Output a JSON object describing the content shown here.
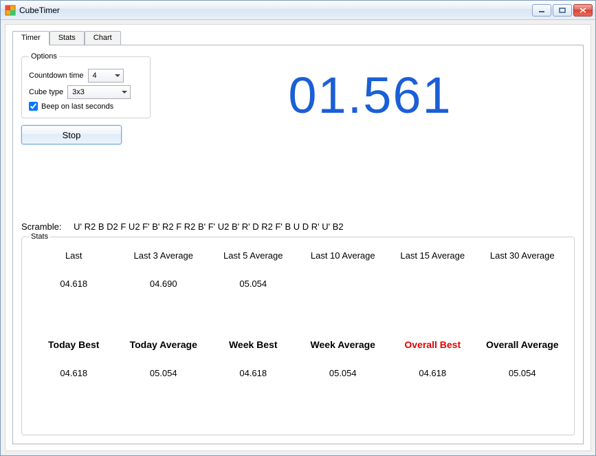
{
  "window": {
    "title": "CubeTimer"
  },
  "tabs": {
    "timer": "Timer",
    "stats": "Stats",
    "chart": "Chart"
  },
  "options": {
    "legend": "Options",
    "countdown_label": "Countdown time",
    "countdown_value": "4",
    "cube_type_label": "Cube type",
    "cube_type_value": "3x3",
    "beep_label": "Beep on last seconds",
    "beep_checked": true
  },
  "main": {
    "stop_label": "Stop",
    "timer_value": "01.561",
    "scramble_label": "Scramble:",
    "scramble_value": "U' R2 B D2 F U2 F' B' R2 F R2 B' F' U2 B' R' D R2 F' B U D R' U' B2"
  },
  "stats": {
    "legend": "Stats",
    "top": {
      "headers": [
        "Last",
        "Last 3 Average",
        "Last 5 Average",
        "Last 10 Average",
        "Last 15 Average",
        "Last 30 Average"
      ],
      "values": [
        "04.618",
        "04.690",
        "05.054",
        "",
        "",
        ""
      ]
    },
    "bottom": {
      "headers": [
        "Today Best",
        "Today Average",
        "Week Best",
        "Week Average",
        "Overall Best",
        "Overall Average"
      ],
      "values": [
        "04.618",
        "05.054",
        "04.618",
        "05.054",
        "04.618",
        "05.054"
      ]
    }
  }
}
